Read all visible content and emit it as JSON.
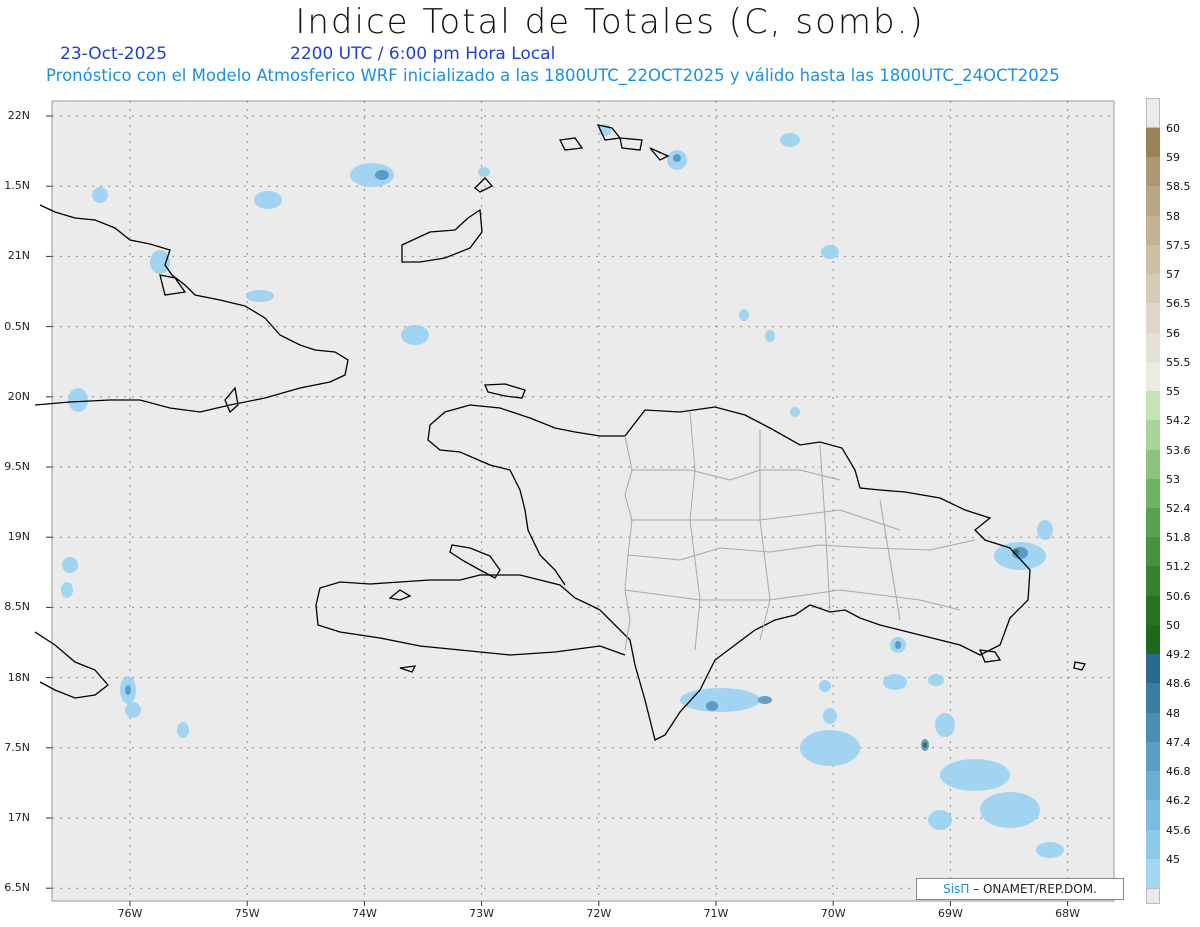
{
  "header": {
    "title": "Indice Total de Totales (C, somb.)",
    "date": "23-Oct-2025",
    "time": "2200 UTC / 6:00 pm Hora Local",
    "forecast": "Pronóstico con el Modelo Atmosferico WRF inicializado a las 1800UTC_22OCT2025 y válido hasta las  1800UTC_24OCT2025"
  },
  "axes": {
    "lat_ticks": [
      "22N",
      "1.5N",
      "21N",
      "0.5N",
      "20N",
      "9.5N",
      "19N",
      "8.5N",
      "18N",
      "7.5N",
      "17N",
      "6.5N"
    ],
    "lon_ticks": [
      "76W",
      "75W",
      "74W",
      "73W",
      "72W",
      "71W",
      "70W",
      "69W",
      "68W"
    ]
  },
  "colorbar": {
    "labels": [
      "60",
      "59",
      "58.5",
      "58",
      "57.5",
      "57",
      "56.5",
      "56",
      "55.5",
      "55",
      "54.2",
      "53.6",
      "53",
      "52.4",
      "51.8",
      "51.2",
      "50.6",
      "50",
      "49.2",
      "48.6",
      "48",
      "47.4",
      "46.8",
      "46.2",
      "45.6",
      "45"
    ],
    "colors": [
      "#9a8258",
      "#ad9874",
      "#b9a684",
      "#c4b396",
      "#cdbea6",
      "#d6cbb6",
      "#ded6c6",
      "#e6e1d6",
      "#ecebe3",
      "#c6e3b8",
      "#a8d49a",
      "#8cc47e",
      "#6fb463",
      "#58a34f",
      "#46933f",
      "#36832f",
      "#26731f",
      "#1c6a1a",
      "#2a6a8e",
      "#3a7ea2",
      "#4a8eb2",
      "#5a9ec2",
      "#6aaed2",
      "#7cbce0",
      "#8ccaeb",
      "#a4d6f2"
    ]
  },
  "credit": {
    "logo": "SisΠ",
    "text": "– ONAMET/REP.DOM."
  }
}
